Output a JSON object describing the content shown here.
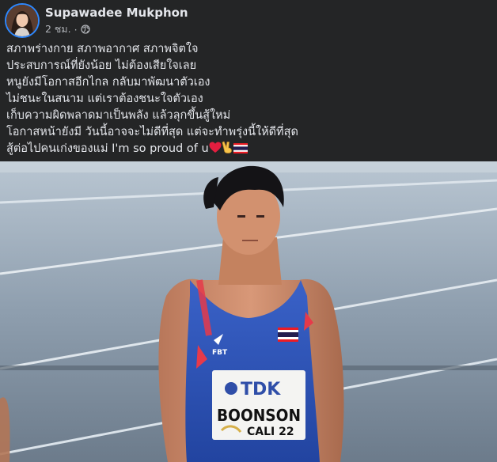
{
  "post": {
    "author": "Supawadee Mukphon",
    "time": "2 ชม.",
    "separator": "·",
    "privacy_icon": "globe-icon",
    "lines": [
      "สภาพร่างกาย สภาพอากาศ สภาพจิตใจ",
      "ประสบการณ์ที่ยังน้อย ไม่ต้องเสียใจเลย",
      "หนูยังมีโอกาสอีกไกล กลับมาพัฒนาตัวเอง",
      "ไม่ชนะในสนาม แต่เราต้องชนะใจตัวเอง",
      "เก็บความผิดพลาดมาเป็นพลัง แล้วลุกขึ้นสู้ใหม่",
      "โอกาสหน้ายังมี วันนี้อาจจะไม่ดีที่สุด แต่จะทำพรุ่งนี้ให้ดีที่สุด"
    ],
    "last_line_text": " สู้ต่อไปคนเก่งของแม่  I'm so proud of u",
    "last_line_emojis": [
      "heart-emoji",
      "victory-hand-emoji",
      "thailand-flag-emoji"
    ]
  },
  "photo": {
    "bib_brand": "TDK",
    "bib_name": "BOONSON",
    "bib_event": "CALI 22",
    "singlet_brand": "FBT"
  },
  "colors": {
    "background": "#242526",
    "text_primary": "#e4e6eb",
    "text_secondary": "#b0b3b8",
    "heart": "#e41e3f",
    "singlet_blue": "#2b4fb5"
  }
}
